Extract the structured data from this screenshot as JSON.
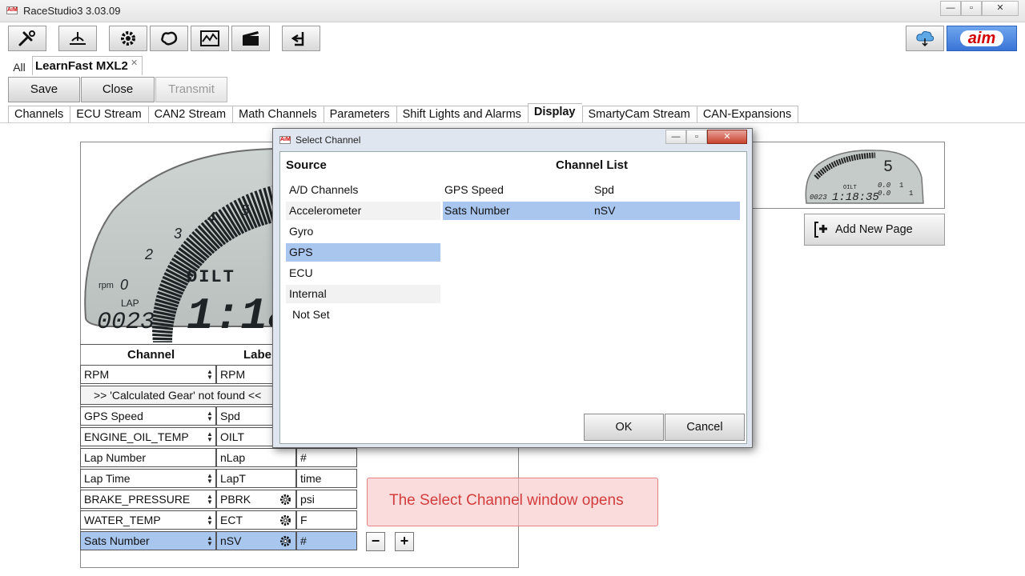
{
  "window": {
    "title": "RaceStudio3 3.03.09",
    "logo_text": "AiM"
  },
  "brand": {
    "logo_text": "aim"
  },
  "tabs": {
    "all": "All",
    "device": "LearnFast MXL2"
  },
  "actions": {
    "save": "Save",
    "close": "Close",
    "transmit": "Transmit"
  },
  "config_tabs": [
    "Channels",
    "ECU Stream",
    "CAN2 Stream",
    "Math Channels",
    "Parameters",
    "Shift Lights and Alarms",
    "Display",
    "SmartyCam Stream",
    "CAN-Expansions"
  ],
  "active_config_tab": "Display",
  "display": {
    "scale": [
      "0",
      "2",
      "3",
      "4",
      "5"
    ],
    "rpm_label": "rpm",
    "oil_label": "OILT",
    "lap_label": "LAP",
    "lap_value": "0023",
    "time_value": "1:18:3"
  },
  "thumbnail": {
    "gear": "5",
    "oil": "OILT",
    "lap": "0023",
    "time": "1:18:35",
    "zero_a": "0.0",
    "zero_b": "0.0",
    "one_a": "1",
    "one_b": "1"
  },
  "add_page": "Add New Page",
  "grid": {
    "header_channel": "Channel",
    "header_label": "Label",
    "warning": ">>  'Calculated Gear'  not found  <<",
    "rows": [
      {
        "channel": "RPM",
        "label": "RPM",
        "unit": ""
      },
      {
        "channel": "GPS Speed",
        "label": "Spd",
        "unit": ""
      },
      {
        "channel": "ENGINE_OIL_TEMP",
        "label": "OILT",
        "unit": ""
      },
      {
        "channel": "Lap Number",
        "label": "nLap",
        "unit": "#"
      },
      {
        "channel": "Lap Time",
        "label": "LapT",
        "unit": "time"
      },
      {
        "channel": "BRAKE_PRESSURE",
        "label": "PBRK",
        "unit": "psi"
      },
      {
        "channel": "WATER_TEMP",
        "label": "ECT",
        "unit": "F"
      },
      {
        "channel": "Sats Number",
        "label": "nSV",
        "unit": "#"
      }
    ],
    "minus": "−",
    "plus": "+"
  },
  "dialog": {
    "title": "Select Channel",
    "source_header": "Source",
    "list_header": "Channel List",
    "sources": [
      "A/D Channels",
      "Accelerometer",
      "Gyro",
      "GPS",
      "ECU",
      "Internal",
      "Not Set"
    ],
    "selected_source": "GPS",
    "channels": [
      {
        "name": "GPS Speed",
        "label": "Spd"
      },
      {
        "name": "Sats Number",
        "label": "nSV"
      }
    ],
    "ok": "OK",
    "cancel": "Cancel"
  },
  "callout": {
    "text": "The Select Channel window opens"
  },
  "colors": {
    "selection": "#a9c6ef",
    "lcd_bg": "#c3cac8",
    "lcd_ink": "#1e2326",
    "callout": "#d23c3c"
  }
}
